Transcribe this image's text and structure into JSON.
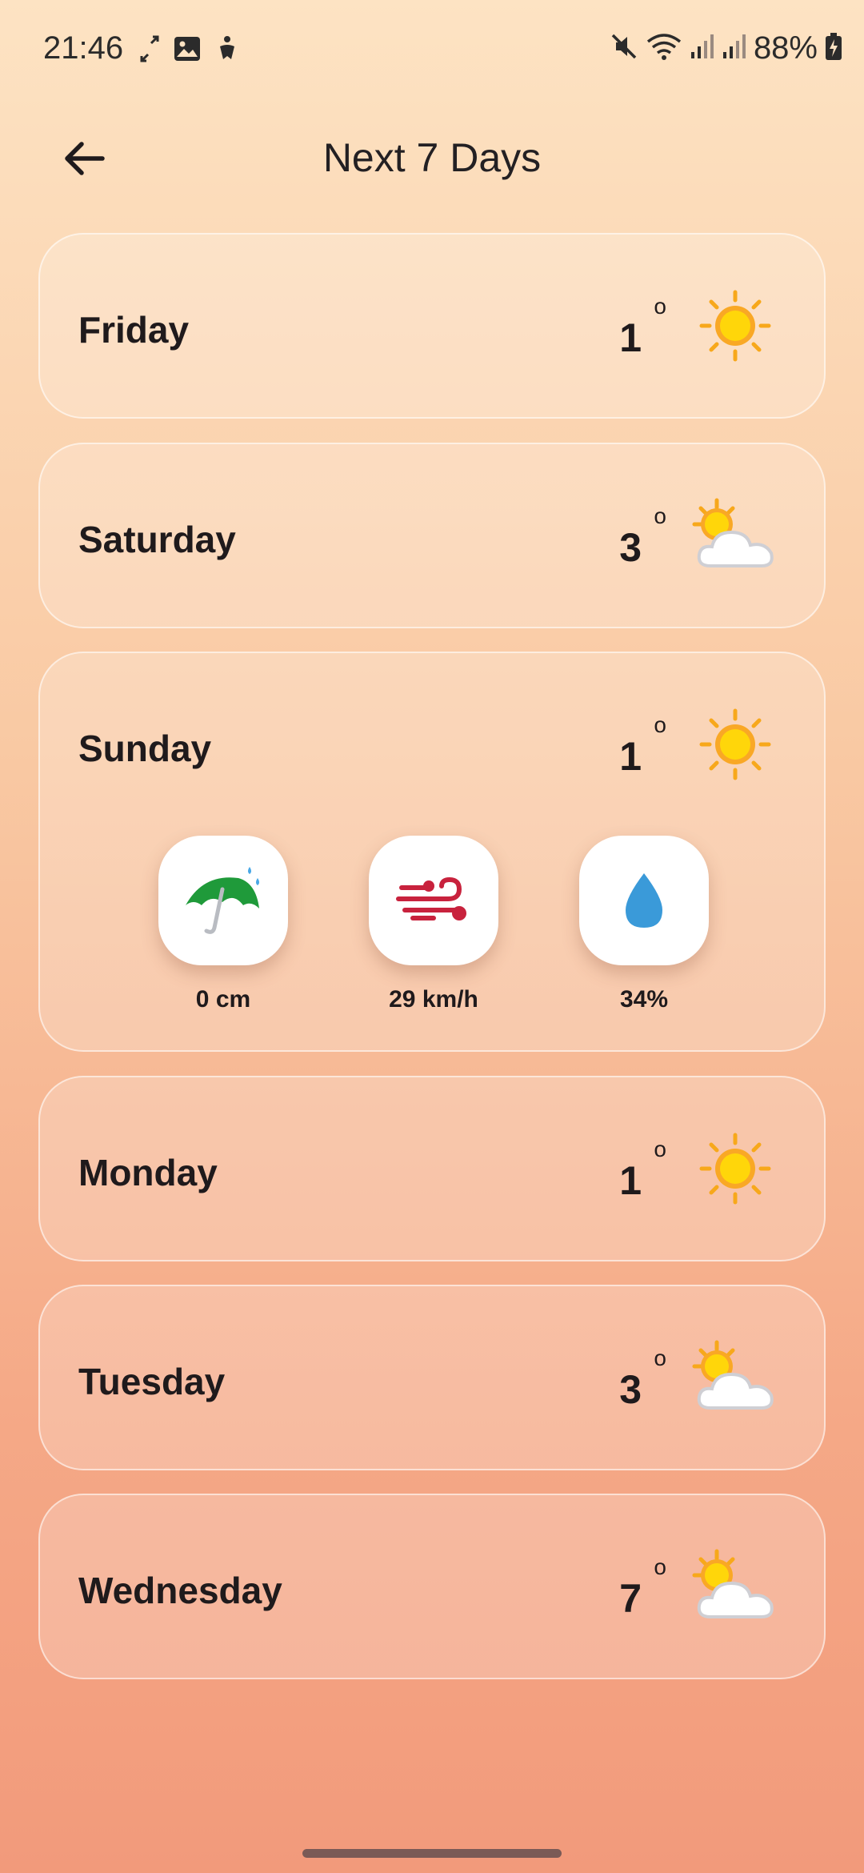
{
  "status_bar": {
    "time": "21:46",
    "left_icons": [
      "cast-icon",
      "gallery-icon",
      "accessibility-icon"
    ],
    "right_icons": [
      "mute-icon",
      "wifi-icon",
      "signal-icon",
      "signal-icon",
      "battery-charging-icon"
    ],
    "battery": "88%"
  },
  "header": {
    "title": "Next 7 Days",
    "back_icon": "back-arrow-icon"
  },
  "days": [
    {
      "name": "Friday",
      "temp": "1",
      "degree": "o",
      "icon": "sun-icon"
    },
    {
      "name": "Saturday",
      "temp": "3",
      "degree": "o",
      "icon": "sun-cloud-icon"
    },
    {
      "name": "Sunday",
      "temp": "1",
      "degree": "o",
      "icon": "sun-icon",
      "expanded": true,
      "details": [
        {
          "icon": "umbrella-icon",
          "label": "0 cm"
        },
        {
          "icon": "wind-icon",
          "label": "29 km/h"
        },
        {
          "icon": "humidity-drop-icon",
          "label": "34%"
        }
      ]
    },
    {
      "name": "Monday",
      "temp": "1",
      "degree": "o",
      "icon": "sun-icon"
    },
    {
      "name": "Tuesday",
      "temp": "3",
      "degree": "o",
      "icon": "sun-cloud-icon"
    },
    {
      "name": "Wednesday",
      "temp": "7",
      "degree": "o",
      "icon": "sun-cloud-icon"
    }
  ],
  "colors": {
    "background_top": "#fde3c3",
    "background_bottom": "#f29a7b",
    "sun": "#ffcc00",
    "umbrella": "#1f9a3a",
    "wind": "#c8223d",
    "drop": "#3a9ad9"
  }
}
